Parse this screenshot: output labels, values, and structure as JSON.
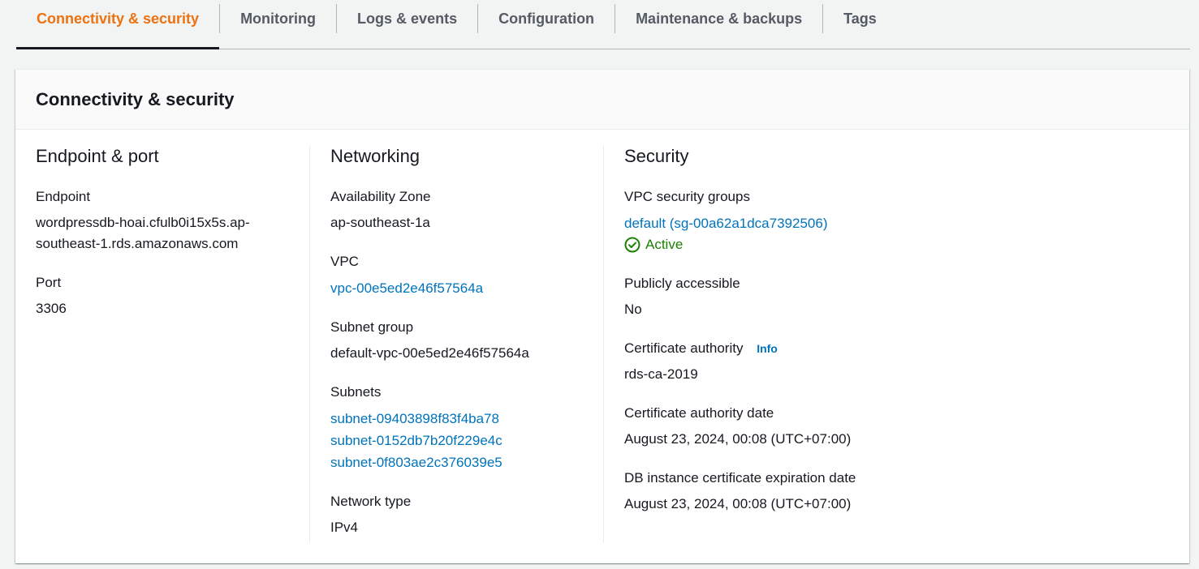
{
  "tabs": [
    {
      "label": "Connectivity & security",
      "active": true
    },
    {
      "label": "Monitoring"
    },
    {
      "label": "Logs & events"
    },
    {
      "label": "Configuration"
    },
    {
      "label": "Maintenance & backups"
    },
    {
      "label": "Tags"
    }
  ],
  "panel": {
    "title": "Connectivity & security"
  },
  "endpoint_port": {
    "title": "Endpoint & port",
    "endpoint_label": "Endpoint",
    "endpoint_value_line1": "wordpressdb-hoai.cfulb0i15x5s.ap-",
    "endpoint_value_line2": "southeast-1.rds.amazonaws.com",
    "port_label": "Port",
    "port_value": "3306"
  },
  "networking": {
    "title": "Networking",
    "az_label": "Availability Zone",
    "az_value": "ap-southeast-1a",
    "vpc_label": "VPC",
    "vpc_value": "vpc-00e5ed2e46f57564a",
    "subnet_group_label": "Subnet group",
    "subnet_group_value": "default-vpc-00e5ed2e46f57564a",
    "subnets_label": "Subnets",
    "subnets": [
      "subnet-09403898f83f4ba78",
      "subnet-0152db7b20f229e4c",
      "subnet-0f803ae2c376039e5"
    ],
    "network_type_label": "Network type",
    "network_type_value": "IPv4"
  },
  "security": {
    "title": "Security",
    "sg_label": "VPC security groups",
    "sg_value": "default (sg-00a62a1dca7392506)",
    "sg_status": "Active",
    "public_label": "Publicly accessible",
    "public_value": "No",
    "ca_label": "Certificate authority",
    "ca_info": "Info",
    "ca_value": "rds-ca-2019",
    "ca_date_label": "Certificate authority date",
    "ca_date_value": "August 23, 2024, 00:08 (UTC+07:00)",
    "expiry_label": "DB instance certificate expiration date",
    "expiry_value": "August 23, 2024, 00:08 (UTC+07:00)"
  },
  "colors": {
    "accent": "#ec7211",
    "link": "#0073bb",
    "success": "#1d8102"
  }
}
